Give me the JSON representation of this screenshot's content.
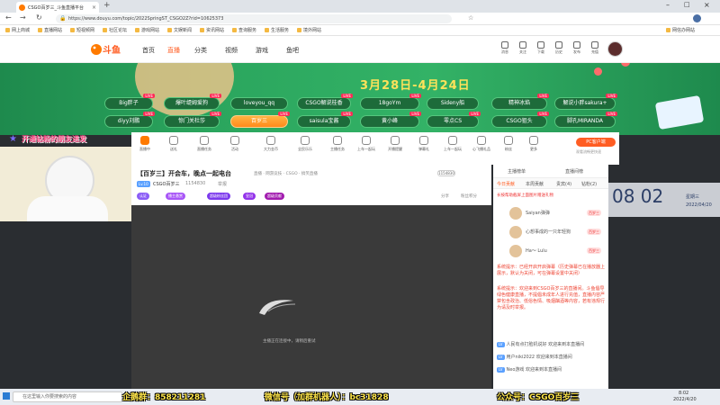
{
  "browser": {
    "tab_title": "CSGO百岁三_斗鱼直播平台",
    "url": "https://www.douyu.com/topic/2022SpringST_CSGO2Z?rid=10625373",
    "bookmarks": [
      "网上商城",
      "直播网站",
      "短视频网",
      "社区论坛",
      "游戏网站",
      "文娱新闻",
      "资讯网站",
      "查询服务",
      "生活服务",
      "境外网站",
      "网信办网站"
    ]
  },
  "site": {
    "logo": "斗鱼",
    "nav": [
      "首页",
      "直播",
      "分类",
      "视频",
      "游戏",
      "鱼吧"
    ],
    "user_icons": [
      "消息",
      "关注",
      "下载",
      "历史",
      "发布",
      "充值"
    ]
  },
  "banner": {
    "dates": "3月28日-4月24日",
    "streamers": [
      "Big胖子",
      "爆叶缇姆爱狗",
      "loveyou_qq",
      "CSGO解说桂香",
      "18goYm",
      "Sideny船",
      "精神冰焰",
      "解说小胖sakura+",
      "diyy刘鹏",
      "惊门关杜莎",
      "百岁三",
      "saisula宝酱",
      "黄小峰",
      "零点CS",
      "CSGO狙头",
      "脚孔MIRANDA"
    ]
  },
  "caption": "开通钻粉的朋友进发",
  "toolbar": {
    "items": [
      "直播中",
      "送礼",
      "直播任务",
      "活动",
      "大力金币",
      "全民乐乐",
      "主播任务",
      "上车一起玩",
      "开播提醒",
      "弹幕礼",
      "上车一起玩",
      "心飞播礼品",
      "粉丝",
      "更多"
    ],
    "pc_label": "PC客户端",
    "pc_sub": "观看流畅更快速"
  },
  "room": {
    "title": "【百岁三】开会车，晚点一起电台",
    "category": "直播 · 网游竞技 · CSGO · 搞笑直播",
    "level": "Lv.10",
    "streamer": "CSGO百岁三",
    "followers": "1154830",
    "badges": [
      "认证",
      "播主悬赏",
      "超级粉丝团",
      "皇冠",
      "超级贡献"
    ],
    "report": "举报",
    "share": "分享",
    "fans": "粉丝积分"
  },
  "video": {
    "message": "主播正在连接中，请稍后重试"
  },
  "rpanel": {
    "header": "主播榜单",
    "header_right": "直播间榜",
    "tabs": [
      "今日贡献",
      "本周贡献",
      "贵宾(4)",
      "钻粉(2)"
    ],
    "tip": "长按帮助截屏上面图片赠送礼物",
    "ranks": [
      {
        "name": "Saiyan弹弹",
        "badge": "百岁三"
      },
      {
        "name": "心想事成的一只年轻狗",
        "badge": "百岁三"
      },
      {
        "name": "Ha～ Lulu",
        "badge": "百岁三"
      }
    ],
    "chats": [
      "系统提示：已经开启开启弹幕（历史弹幕已在播放器上展示，默认为关闭，可在弹幕设置中关闭）",
      "系统提示：欢迎来到CSGO百岁三的直播间。斗鱼倡导绿色健康直播，不提倡未成年人进行充值，直播内容严禁包含政治、低俗色情、吸烟酗酒等内容，若有违规行为请及时举报。",
      "人民有点打脸机说好 欢迎来到本直播间",
      "用户niki2022 欢迎来到本直播间",
      "Neo游戏 欢迎来到本直播间"
    ],
    "clock_time": "08 02",
    "clock_day": "星期三",
    "clock_date": "2022/04/20"
  },
  "taskbar": {
    "search": "在这里输入你要搜索的内容",
    "ad1": "企鹅群：858211281",
    "ad2": "微信号（加群机器人）：bc31828",
    "ad3": "公众号：CSGO百岁三",
    "time": "8:02",
    "date": "2022/4/20"
  }
}
